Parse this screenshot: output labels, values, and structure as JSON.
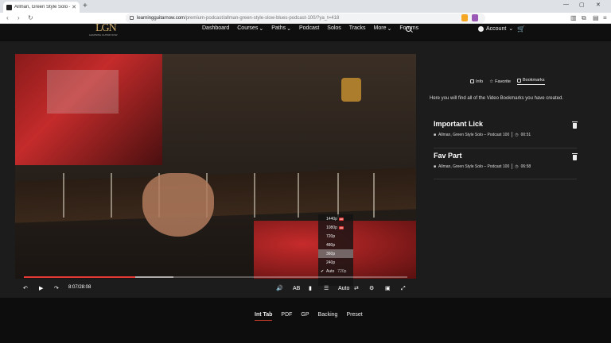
{
  "browser": {
    "tab_title": "Allman, Green Style Solo – Podc",
    "url_host": "learningguitarnow.com",
    "url_path": "/premium-podcast/allman-green-style-slow-blues-podcast-100/?ya_t=418"
  },
  "site": {
    "logo_text": "LGN",
    "logo_sub": "LEARNING GUITAR NOW",
    "nav": [
      "Dashboard",
      "Courses",
      "Paths",
      "Podcast",
      "Solos",
      "Tracks",
      "More",
      "Forums"
    ],
    "nav_dropdown": [
      false,
      true,
      true,
      false,
      false,
      false,
      true,
      false
    ],
    "account_label": "Account"
  },
  "video": {
    "time_display": "8:07/28:08",
    "progress_fraction": 0.29,
    "buffered_fraction": 0.39,
    "ab_label": "AB",
    "quality_label": "Auto",
    "quality_options": [
      {
        "label": "1440p",
        "hd": "HD"
      },
      {
        "label": "1080p",
        "hd": "HD"
      },
      {
        "label": "720p",
        "hd": ""
      },
      {
        "label": "480p",
        "hd": ""
      },
      {
        "label": "360p",
        "hd": "",
        "hovered": true
      },
      {
        "label": "240p",
        "hd": ""
      },
      {
        "label": "Auto",
        "hd": "",
        "checked": true,
        "note": "720p"
      }
    ]
  },
  "sidebar": {
    "tabs": [
      "Info",
      "Favorite",
      "Bookmarks"
    ],
    "active_tab": "Bookmarks",
    "description": "Here you will find all of the Video Bookmarks you have created.",
    "bookmarks": [
      {
        "title": "Important Lick",
        "lesson": "Allman, Green Style Solo – Podcast 100",
        "time": "00:51"
      },
      {
        "title": "Fav Part",
        "lesson": "Allman, Green Style Solo – Podcast 100",
        "time": "06:58"
      }
    ]
  },
  "bottom_tabs": [
    "Int Tab",
    "PDF",
    "GP",
    "Backing",
    "Preset"
  ],
  "active_bottom_tab": "Int Tab",
  "colors": {
    "accent": "#e53935",
    "panel": "#1c1c1c",
    "background": "#0d0d0d"
  }
}
